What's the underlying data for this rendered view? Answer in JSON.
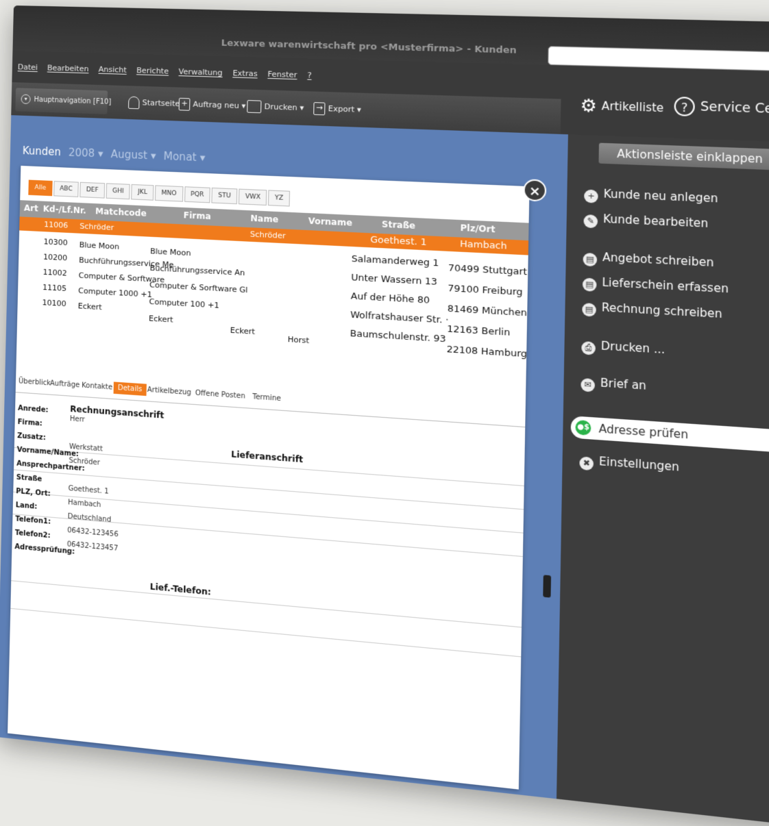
{
  "window": {
    "title": "Lexware warenwirtschaft pro <Musterfirma> - Kunden",
    "controls": "_ □"
  },
  "menu": [
    "Datei",
    "Bearbeiten",
    "Ansicht",
    "Berichte",
    "Verwaltung",
    "Extras",
    "Fenster",
    "?"
  ],
  "toolbar": {
    "hauptnavigation": "Hauptnavigation [F10]",
    "startseite": "Startseite",
    "auftrag_neu": "Auftrag neu ▾",
    "drucken": "Drucken ▾",
    "export": "Export ▾"
  },
  "top_right": {
    "artikelliste": "Artikelliste",
    "service_center": "Service Center"
  },
  "breadcrumb": {
    "section": "Kunden",
    "year": "2008 ▾",
    "month": "August ▾",
    "period": "Monat ▾"
  },
  "letter_tabs": [
    "Alle",
    "ABC",
    "DEF",
    "GHI",
    "JKL",
    "MNO",
    "PQR",
    "STU",
    "VWX",
    "YZ"
  ],
  "table": {
    "columns": [
      "Art",
      "Kd-/Lf.Nr.",
      "Matchcode",
      "Firma",
      "Name",
      "Vorname",
      "Straße",
      "Plz/Ort"
    ],
    "selected_row": {
      "nr": "11006",
      "matchcode": "Schröder",
      "name": "Schröder",
      "strasse": "Goethest. 1",
      "ort": "Hambach"
    },
    "nr_col": [
      "10300",
      "10200",
      "11002",
      "11105",
      "10100"
    ],
    "matchcode_col": [
      "Blue Moon",
      "Buchführungsservice Me",
      "Computer & Sorftware",
      "Computer 1000 +1",
      "Eckert"
    ],
    "firma_col": [
      "Blue Moon",
      "Buchführungsservice An",
      "Computer & Sorftware Gl",
      "Computer 100 +1",
      "Eckert"
    ],
    "name_extra": "Eckert",
    "vorname_extra": "Horst",
    "strasse_col": [
      "Salamanderweg 1",
      "Unter Wassern 13",
      "Auf der Höhe 80",
      "Wolfratshauser Str. ·",
      "Baumschulenstr. 93"
    ],
    "ort_col": [
      "70499 Stuttgart",
      "79100 Freiburg",
      "81469 München",
      "12163 Berlin",
      "22108 Hamburg"
    ]
  },
  "subtabs": [
    "Überblick",
    "Aufträge",
    "Kontakte",
    "Details",
    "Artikelbezug",
    "Offene Posten",
    "Termine"
  ],
  "details": {
    "rechnungsanschrift": "Rechnungsanschrift",
    "lieferanschrift": "Lieferanschrift",
    "lief_telefon": "Lief.-Telefon:",
    "labels": [
      "Anrede:",
      "Firma:",
      "Zusatz:",
      "Vorname/Name:",
      "Ansprechpartner:",
      "Straße",
      "PLZ, Ort:",
      "Land:",
      "Telefon1:",
      "Telefon2:",
      "Adressprüfung:"
    ],
    "values": {
      "anrede": "Herr",
      "zusatz": "Werkstatt",
      "name": "Schröder",
      "strasse": "Goethest. 1",
      "ort": "Hambach",
      "land": "Deutschland",
      "tel1": "06432-123456",
      "tel2": "06432-123457"
    }
  },
  "sidebar": {
    "collapse": "Aktionsleiste einklappen",
    "actions": [
      "Kunde neu anlegen",
      "Kunde bearbeiten",
      "Angebot schreiben",
      "Lieferschein erfassen",
      "Rechnung schreiben",
      "Drucken ...",
      "Brief an"
    ],
    "adresse": "Adresse prüfen",
    "einstellungen": "Einstellungen"
  },
  "colors": {
    "accent": "#f07b1c",
    "workspace": "#5d7fb6",
    "sidebar": "#3d3d3d",
    "ok": "#2bb34a"
  }
}
